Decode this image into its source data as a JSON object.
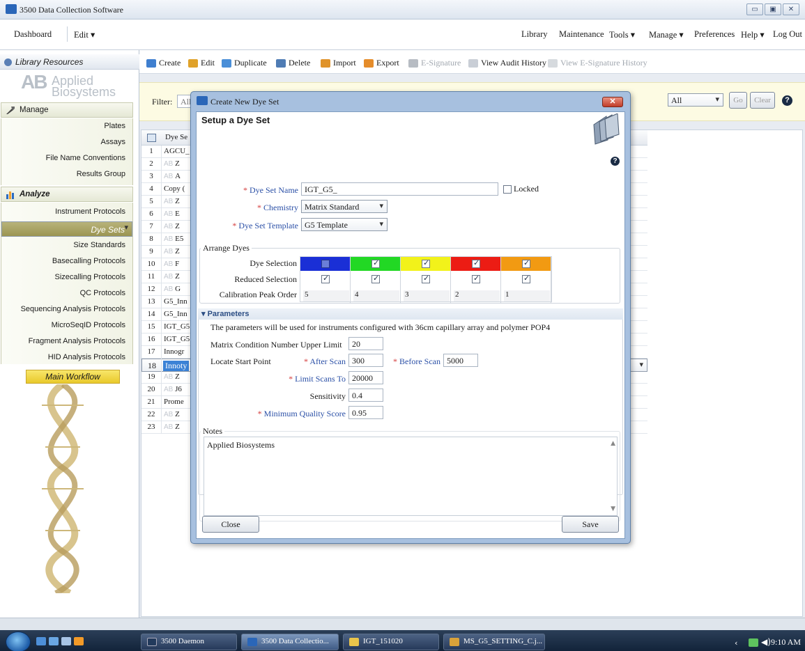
{
  "app": {
    "title": "3500 Data Collection Software"
  },
  "window_buttons": [
    "▭",
    "▣",
    "✕"
  ],
  "menubar": {
    "left": [
      "Dashboard",
      "Edit ▾"
    ],
    "right": [
      "Library",
      "Maintenance",
      "Tools ▾",
      "Manage ▾",
      "Preferences",
      "Help ▾",
      "Log Out"
    ]
  },
  "left_panel": {
    "header": "Library Resources",
    "logo": {
      "mark": "AB",
      "line1": "Applied",
      "line2": "Biosystems"
    },
    "manage": {
      "title": "Manage",
      "items": [
        "Plates",
        "Assays",
        "File Name Conventions",
        "Results Group"
      ]
    },
    "analyze": {
      "title": "Analyze",
      "items": [
        "Instrument Protocols",
        "Dye Sets",
        "Size Standards",
        "Basecalling Protocols",
        "Sizecalling Protocols",
        "QC Protocols",
        "Sequencing Analysis Protocols",
        "MicroSeqID Protocols",
        "Fragment Analysis Protocols",
        "HID Analysis Protocols"
      ],
      "selected": "Dye Sets"
    },
    "workflow_button": "Main Workflow"
  },
  "toolbar": [
    {
      "label": "Create",
      "enabled": true,
      "color": "#3f7fcf"
    },
    {
      "label": "Edit",
      "enabled": true,
      "color": "#e0a22a"
    },
    {
      "label": "Duplicate",
      "enabled": true,
      "color": "#4a8fd8"
    },
    {
      "label": "Delete",
      "enabled": true,
      "color": "#4f7cb4"
    },
    {
      "label": "Import",
      "enabled": true,
      "color": "#e0932a"
    },
    {
      "label": "Export",
      "enabled": true,
      "color": "#e58c2a"
    },
    {
      "label": "E-Signature",
      "enabled": false,
      "color": "#b7bcc3"
    },
    {
      "label": "View Audit History",
      "enabled": true,
      "color": "#c9ced6"
    },
    {
      "label": "View E-Signature History",
      "enabled": false,
      "color": "#d6dade"
    }
  ],
  "filter": {
    "label": "Filter:",
    "value": "All",
    "select_value": "All",
    "go": "Go",
    "clear": "Clear"
  },
  "table": {
    "column": "Dye Se",
    "rows": [
      {
        "n": "1",
        "name": "AGCU_",
        "ab": false
      },
      {
        "n": "2",
        "name": "Z",
        "ab": true
      },
      {
        "n": "3",
        "name": "A",
        "ab": true
      },
      {
        "n": "4",
        "name": "Copy (",
        "ab": false
      },
      {
        "n": "5",
        "name": "Z",
        "ab": true
      },
      {
        "n": "6",
        "name": "E",
        "ab": true
      },
      {
        "n": "7",
        "name": "Z",
        "ab": true
      },
      {
        "n": "8",
        "name": "E5",
        "ab": true
      },
      {
        "n": "9",
        "name": "Z",
        "ab": true
      },
      {
        "n": "10",
        "name": "F",
        "ab": true
      },
      {
        "n": "11",
        "name": "Z",
        "ab": true
      },
      {
        "n": "12",
        "name": "G",
        "ab": true
      },
      {
        "n": "13",
        "name": "G5_Inn",
        "ab": false
      },
      {
        "n": "14",
        "name": "G5_Inn",
        "ab": false
      },
      {
        "n": "15",
        "name": "IGT_G5",
        "ab": false
      },
      {
        "n": "16",
        "name": "IGT_G5",
        "ab": false
      },
      {
        "n": "17",
        "name": "Innogr",
        "ab": false
      },
      {
        "n": "18",
        "name": "Innoty",
        "ab": false,
        "selected": true
      },
      {
        "n": "19",
        "name": "Z",
        "ab": true
      },
      {
        "n": "20",
        "name": "J6",
        "ab": true
      },
      {
        "n": "21",
        "name": "Prome",
        "ab": false
      },
      {
        "n": "22",
        "name": "Z",
        "ab": true
      },
      {
        "n": "23",
        "name": "Z",
        "ab": true
      }
    ]
  },
  "dialog": {
    "title": "Create New Dye Set",
    "heading": "Setup a Dye Set",
    "help": "?",
    "dye_set_name": {
      "label": "Dye Set Name",
      "value": "IGT_G5_"
    },
    "locked": {
      "label": "Locked",
      "checked": false
    },
    "chemistry": {
      "label": "Chemistry",
      "value": "Matrix Standard"
    },
    "template": {
      "label": "Dye Set Template",
      "value": "G5 Template"
    },
    "arrange": {
      "title": "Arrange Dyes",
      "row_labels": [
        "Dye Selection",
        "Reduced Selection",
        "Calibration Peak Order"
      ],
      "dyes": [
        {
          "color": "#1a2fd6",
          "selected": false,
          "reduced": true,
          "peak": "5"
        },
        {
          "color": "#22d824",
          "selected": true,
          "reduced": true,
          "peak": "4"
        },
        {
          "color": "#f2f21a",
          "selected": true,
          "reduced": true,
          "peak": "3"
        },
        {
          "color": "#ec1c14",
          "selected": true,
          "reduced": true,
          "peak": "2"
        },
        {
          "color": "#f29a12",
          "selected": true,
          "reduced": true,
          "peak": "1"
        }
      ]
    },
    "parameters": {
      "title": "Parameters",
      "note": "The parameters will be used for instruments configured with 36cm capillary array and polymer POP4",
      "matrix_condition": {
        "label": "Matrix Condition Number Upper Limit",
        "value": "20"
      },
      "locate_start": "Locate Start Point",
      "after_scan": {
        "label": "After Scan",
        "value": "300"
      },
      "before_scan": {
        "label": "Before Scan",
        "value": "5000"
      },
      "limit_scans": {
        "label": "Limit Scans To",
        "value": "20000"
      },
      "sensitivity": {
        "label": "Sensitivity",
        "value": "0.4"
      },
      "min_quality": {
        "label": "Minimum Quality Score",
        "value": "0.95"
      }
    },
    "notes": {
      "title": "Notes",
      "value": "Applied Biosystems"
    },
    "close": "Close",
    "save": "Save"
  },
  "taskbar": {
    "tasks": [
      "3500 Daemon",
      "3500 Data Collectio...",
      "IGT_151020",
      "MS_G5_SETTING_C.j..."
    ],
    "clock": "9:10 AM"
  }
}
